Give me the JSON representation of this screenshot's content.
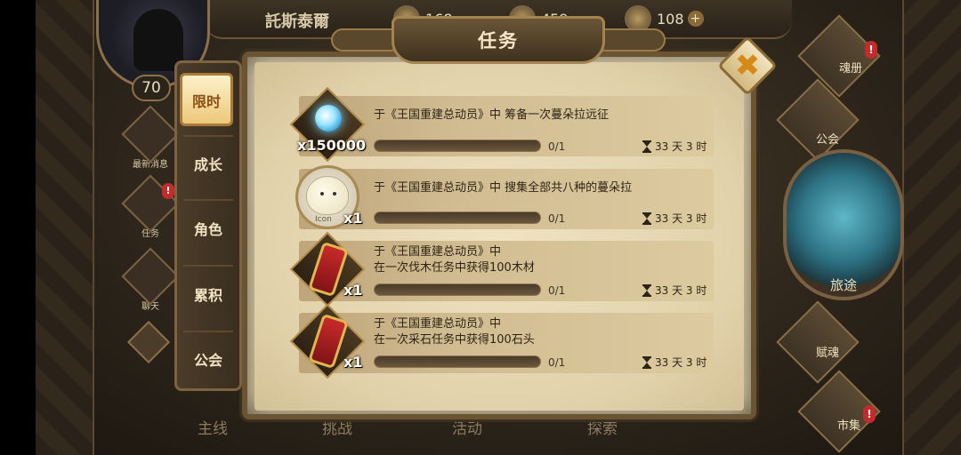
{
  "player": {
    "name": "託斯泰爾",
    "level": "70"
  },
  "resources": [
    {
      "icon": "gold-coin-icon",
      "value": "168"
    },
    {
      "icon": "gem-icon",
      "value": "459"
    },
    {
      "icon": "stamina-icon",
      "value": "108"
    }
  ],
  "left_menu": [
    {
      "label": "最新消息",
      "icon": "cat-icon",
      "badge": ""
    },
    {
      "label": "任务",
      "icon": "shield-icon",
      "badge": "!"
    },
    {
      "label": "聊天",
      "icon": "chat-icon",
      "badge": ""
    }
  ],
  "right_menu": [
    {
      "label": "魂册",
      "icon": "soul-book-icon",
      "badge": "!"
    },
    {
      "label": "公会",
      "icon": "guild-icon",
      "badge": ""
    },
    {
      "label": "旅途",
      "icon": "journey-icon",
      "badge": ""
    },
    {
      "label": "赋魂",
      "icon": "soul-enchant-icon",
      "badge": ""
    },
    {
      "label": "市集",
      "icon": "market-icon",
      "badge": "!"
    }
  ],
  "bottom_nav": [
    "主线",
    "挑战",
    "活动",
    "探索"
  ],
  "panel": {
    "title": "任务",
    "close_icon": "close-icon",
    "tabs": [
      "限时",
      "成长",
      "角色",
      "累积",
      "公会"
    ],
    "active_tab": "限时"
  },
  "tasks": [
    {
      "line1": "于《王国重建总动员》中 筹备一次蔓朵拉远征",
      "line2": "",
      "reward_qty": "x150000",
      "reward_icon": "spirit-orb-icon",
      "progress": "0/1",
      "progress_fraction": 0,
      "time_left": "33 天 3 时"
    },
    {
      "line1": "于《王国重建总动员》中 搜集全部共八种的蔓朵拉",
      "line2": "",
      "reward_qty": "x1",
      "reward_icon": "mandora-icon",
      "reward_tag": "Icon",
      "progress": "0/1",
      "progress_fraction": 0,
      "time_left": "33 天 3 时"
    },
    {
      "line1": "于《王国重建总动员》中",
      "line2": "在一次伐木任务中获得100木材",
      "reward_qty": "x1",
      "reward_icon": "scroll-icon",
      "progress": "0/1",
      "progress_fraction": 0,
      "time_left": "33 天 3 时"
    },
    {
      "line1": "于《王国重建总动员》中",
      "line2": "在一次采石任务中获得100石头",
      "reward_qty": "x1",
      "reward_icon": "scroll-icon",
      "progress": "0/1",
      "progress_fraction": 0,
      "time_left": "33 天 3 时"
    }
  ],
  "colors": {
    "accent": "#d58a18",
    "badge": "#c42b2b",
    "parchment": "#e9dbb8"
  }
}
